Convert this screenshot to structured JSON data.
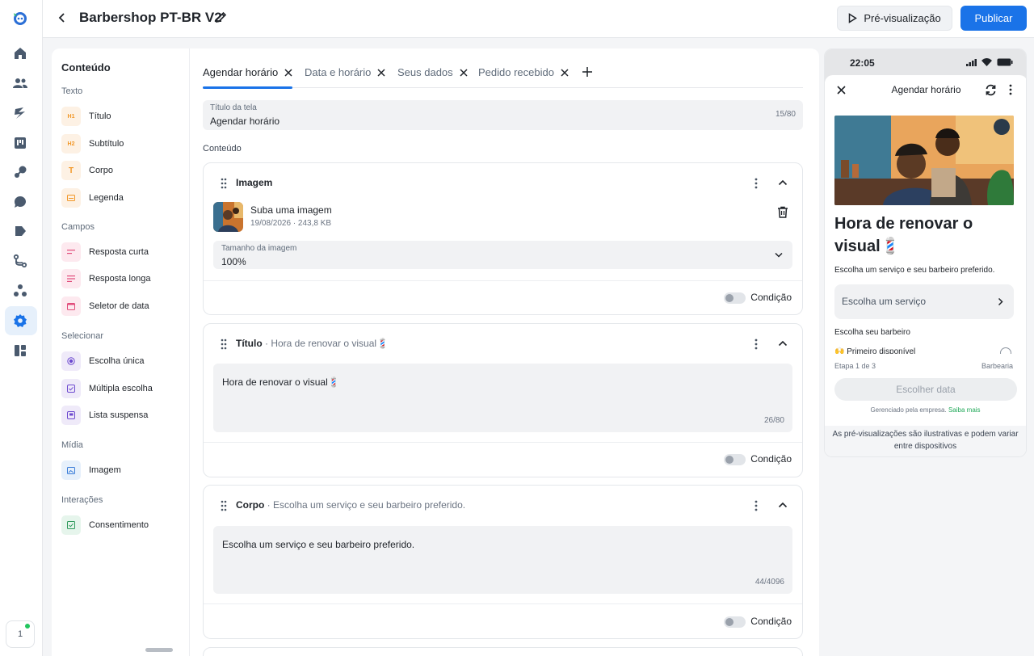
{
  "header": {
    "title": "Barbershop PT-BR V2",
    "preview_label": "Pré-visualização",
    "publish_label": "Publicar"
  },
  "rail": {
    "workspace_badge": "1",
    "icons": [
      "home-icon",
      "contacts-icon",
      "automation-icon",
      "board-icon",
      "integrations-icon",
      "chat-icon",
      "broadcast-icon",
      "flows-icon",
      "team-icon",
      "settings-icon",
      "apps-icon"
    ]
  },
  "palette": {
    "heading": "Conteúdo",
    "sections": {
      "texto": "Texto",
      "campos": "Campos",
      "selecionar": "Selecionar",
      "midia": "Mídia",
      "interacoes": "Interações"
    },
    "items": {
      "titulo": {
        "label": "Título",
        "icon_text": "H1"
      },
      "subtitulo": {
        "label": "Subtítulo",
        "icon_text": "H2"
      },
      "corpo": {
        "label": "Corpo",
        "icon_text": "T"
      },
      "legenda": {
        "label": "Legenda"
      },
      "resposta_curta": {
        "label": "Resposta curta"
      },
      "resposta_longa": {
        "label": "Resposta longa"
      },
      "seletor_data": {
        "label": "Seletor de data"
      },
      "escolha_unica": {
        "label": "Escolha única"
      },
      "multipla": {
        "label": "Múltipla escolha"
      },
      "lista": {
        "label": "Lista suspensa"
      },
      "imagem": {
        "label": "Imagem"
      },
      "consentimento": {
        "label": "Consentimento"
      }
    }
  },
  "tabs": [
    {
      "label": "Agendar horário"
    },
    {
      "label": "Data e horário"
    },
    {
      "label": "Seus dados"
    },
    {
      "label": "Pedido recebido"
    }
  ],
  "screen_title": {
    "label": "Título da tela",
    "value": "Agendar horário",
    "count": "15/80"
  },
  "content_label": "Conteúdo",
  "cards": {
    "image": {
      "title": "Imagem",
      "upload_name": "Suba uma imagem",
      "upload_meta": "19/08/2026 · 243,8 KB",
      "size_label": "Tamanho da imagem",
      "size_value": "100%",
      "condition": "Condição"
    },
    "titulo": {
      "title": "Título",
      "subtitle": " · Hora de renovar o visual💈",
      "text": "Hora de renovar o visual💈",
      "count": "26/80",
      "condition": "Condição"
    },
    "corpo": {
      "title": "Corpo",
      "subtitle": " · Escolha um serviço e seu barbeiro preferido.",
      "text": "Escolha um serviço e seu barbeiro preferido.",
      "count": "44/4096",
      "condition": "Condição"
    }
  },
  "preview": {
    "time": "22:05",
    "sheet_title": "Agendar horário",
    "heading": "Hora de renovar o visual💈",
    "body": "Escolha um serviço e seu barbeiro preferido.",
    "service_placeholder": "Escolha um serviço",
    "barber_label": "Escolha seu barbeiro",
    "first_option": "🙌 Primeiro disponível",
    "step": "Etapa 1 de 3",
    "business": "Barbearia",
    "cta": "Escolher data",
    "managed": "Gerenciado pela empresa.",
    "learn_more": "Saiba mais",
    "disclaimer": "As pré-visualizações são ilustrativas e podem variar entre dispositivos"
  },
  "colors": {
    "accent": "#1a73e8",
    "link_green": "#22a95a"
  }
}
